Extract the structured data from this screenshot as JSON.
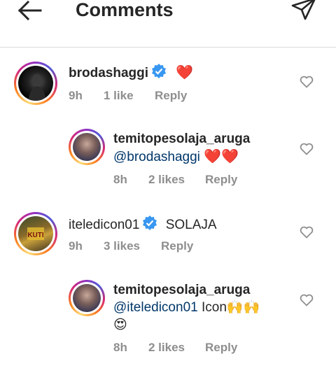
{
  "header": {
    "title": "Comments",
    "back_icon": "arrow-left-icon",
    "share_icon": "paper-plane-icon"
  },
  "comments": [
    {
      "username": "brodashaggi",
      "verified": true,
      "text": "❤️",
      "time": "9h",
      "likes": "1 like",
      "reply": "Reply",
      "is_reply": false
    },
    {
      "username": "temitopesolaja_aruga",
      "verified": false,
      "mention": "@brodashaggi",
      "text": "❤️❤️",
      "time": "8h",
      "likes": "2 likes",
      "reply": "Reply",
      "is_reply": true
    },
    {
      "username": "iteledicon01",
      "verified": true,
      "text": "SOLAJA",
      "time": "9h",
      "likes": "3 likes",
      "reply": "Reply",
      "is_reply": false
    },
    {
      "username": "temitopesolaja_aruga",
      "verified": false,
      "mention": "@iteledicon01",
      "text": "Icon🙌🙌",
      "text2": "😍",
      "time": "8h",
      "likes": "2 likes",
      "reply": "Reply",
      "is_reply": true
    }
  ],
  "colors": {
    "verified": "#3897f0",
    "heart": "#ed1c24",
    "mention": "#00376b",
    "meta": "#8e8e8e"
  }
}
